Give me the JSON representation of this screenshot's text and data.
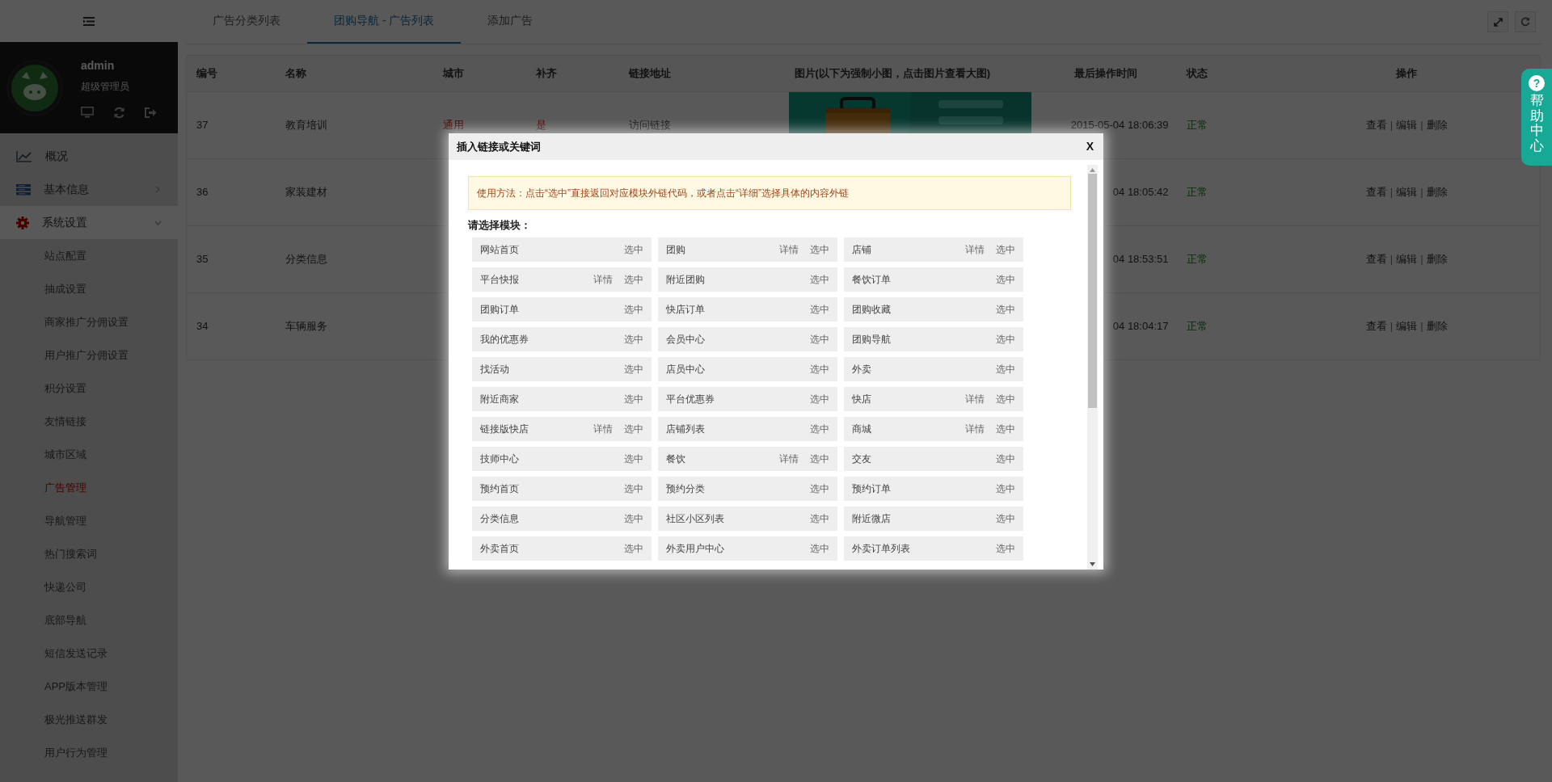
{
  "sidebar": {
    "user": {
      "name": "admin",
      "role": "超级管理员"
    },
    "items": [
      {
        "label": "概况",
        "kind": "link",
        "expanded": false
      },
      {
        "label": "基本信息",
        "kind": "group",
        "expanded": false
      },
      {
        "label": "系统设置",
        "kind": "group",
        "expanded": true,
        "children": [
          {
            "label": "站点配置",
            "selected": false
          },
          {
            "label": "抽成设置",
            "selected": false
          },
          {
            "label": "商家推广分佣设置",
            "selected": false
          },
          {
            "label": "用户推广分佣设置",
            "selected": false
          },
          {
            "label": "积分设置",
            "selected": false
          },
          {
            "label": "友情链接",
            "selected": false
          },
          {
            "label": "城市区域",
            "selected": false
          },
          {
            "label": "广告管理",
            "selected": true
          },
          {
            "label": "导航管理",
            "selected": false
          },
          {
            "label": "热门搜索词",
            "selected": false
          },
          {
            "label": "快递公司",
            "selected": false
          },
          {
            "label": "底部导航",
            "selected": false
          },
          {
            "label": "短信发送记录",
            "selected": false
          },
          {
            "label": "APP版本管理",
            "selected": false
          },
          {
            "label": "极光推送群发",
            "selected": false
          },
          {
            "label": "用户行为管理",
            "selected": false
          }
        ]
      }
    ]
  },
  "tabs": [
    {
      "label": "广告分类列表",
      "selected": false
    },
    {
      "label": "团购导航 - 广告列表",
      "selected": true
    },
    {
      "label": "添加广告",
      "selected": false
    }
  ],
  "table": {
    "columns": [
      "编号",
      "名称",
      "城市",
      "补齐",
      "链接地址",
      "图片(以下为强制小图，点击图片查看大图)",
      "最后操作时间",
      "状态",
      "操作"
    ],
    "rows": [
      {
        "id": "37",
        "name": "教育培训",
        "city": "通用",
        "fill": "是",
        "link": "访问链接",
        "time": "2015-05-04 18:06:39",
        "status": "正常",
        "actions": [
          {
            "kind": "link",
            "text": "查看"
          },
          {
            "kind": "separator",
            "text": "|"
          },
          {
            "kind": "link",
            "text": "编辑"
          },
          {
            "kind": "separator",
            "text": "|"
          },
          {
            "kind": "link",
            "text": "删除"
          }
        ]
      },
      {
        "id": "36",
        "name": "家装建材",
        "time": "04 18:05:42",
        "status": "正常",
        "actions": [
          {
            "kind": "link",
            "text": "查看"
          },
          {
            "kind": "separator",
            "text": "|"
          },
          {
            "kind": "link",
            "text": "编辑"
          },
          {
            "kind": "separator",
            "text": "|"
          },
          {
            "kind": "link",
            "text": "删除"
          }
        ]
      },
      {
        "id": "35",
        "name": "分类信息",
        "time": "04 18:53:51",
        "status": "正常",
        "actions": [
          {
            "kind": "link",
            "text": "查看"
          },
          {
            "kind": "separator",
            "text": "|"
          },
          {
            "kind": "link",
            "text": "编辑"
          },
          {
            "kind": "separator",
            "text": "|"
          },
          {
            "kind": "link",
            "text": "删除"
          }
        ]
      },
      {
        "id": "34",
        "name": "车辆服务",
        "time": "04 18:04:17",
        "status": "正常",
        "actions": [
          {
            "kind": "link",
            "text": "查看"
          },
          {
            "kind": "separator",
            "text": "|"
          },
          {
            "kind": "link",
            "text": "编辑"
          },
          {
            "kind": "separator",
            "text": "|"
          },
          {
            "kind": "link",
            "text": "删除"
          }
        ]
      }
    ]
  },
  "modal": {
    "title": "插入链接或关键词",
    "close": "X",
    "notice": "使用方法：点击“选中”直接返回对应模块外链代码，或者点击“详细”选择具体的内容外链",
    "prompt": "请选择模块：",
    "modules": [
      {
        "name": "网站首页",
        "select": "选中"
      },
      {
        "name": "团购",
        "detail": "详情",
        "select": "选中"
      },
      {
        "name": "店铺",
        "detail": "详情",
        "select": "选中"
      },
      {
        "name": "平台快报",
        "detail": "详情",
        "select": "选中"
      },
      {
        "name": "附近团购",
        "select": "选中"
      },
      {
        "name": "餐饮订单",
        "select": "选中"
      },
      {
        "name": "团购订单",
        "select": "选中"
      },
      {
        "name": "快店订单",
        "select": "选中"
      },
      {
        "name": "团购收藏",
        "select": "选中"
      },
      {
        "name": "我的优惠券",
        "select": "选中"
      },
      {
        "name": "会员中心",
        "select": "选中"
      },
      {
        "name": "团购导航",
        "select": "选中"
      },
      {
        "name": "找活动",
        "select": "选中"
      },
      {
        "name": "店员中心",
        "select": "选中"
      },
      {
        "name": "外卖",
        "select": "选中"
      },
      {
        "name": "附近商家",
        "select": "选中"
      },
      {
        "name": "平台优惠券",
        "select": "选中"
      },
      {
        "name": "快店",
        "detail": "详情",
        "select": "选中"
      },
      {
        "name": "链接版快店",
        "detail": "详情",
        "select": "选中"
      },
      {
        "name": "店铺列表",
        "select": "选中"
      },
      {
        "name": "商城",
        "detail": "详情",
        "select": "选中"
      },
      {
        "name": "技师中心",
        "select": "选中"
      },
      {
        "name": "餐饮",
        "detail": "详情",
        "select": "选中"
      },
      {
        "name": "交友",
        "select": "选中"
      },
      {
        "name": "预约首页",
        "select": "选中"
      },
      {
        "name": "预约分类",
        "select": "选中"
      },
      {
        "name": "预约订单",
        "select": "选中"
      },
      {
        "name": "分类信息",
        "select": "选中"
      },
      {
        "name": "社区小区列表",
        "select": "选中"
      },
      {
        "name": "附近微店",
        "select": "选中"
      },
      {
        "name": "外卖首页",
        "select": "选中"
      },
      {
        "name": "外卖用户中心",
        "select": "选中"
      },
      {
        "name": "外卖订单列表",
        "select": "选中"
      }
    ]
  },
  "help": {
    "icon": "?",
    "label": "帮助中心"
  }
}
